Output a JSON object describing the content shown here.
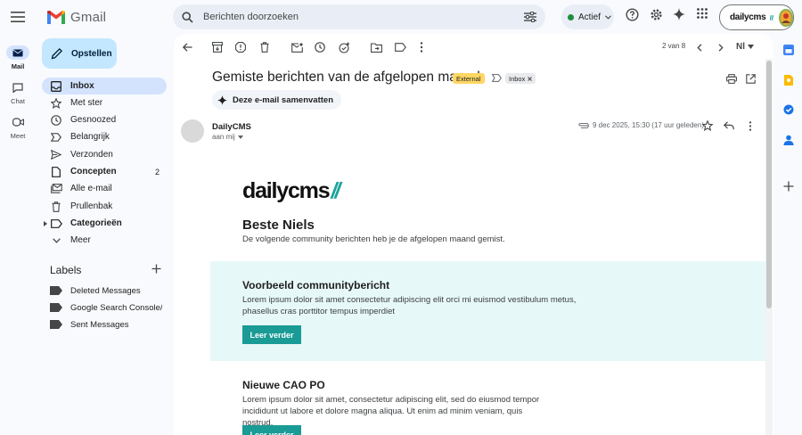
{
  "app": {
    "logo_text": "Gmail"
  },
  "search": {
    "placeholder": "Berichten doorzoeken"
  },
  "status": {
    "label": "Actief",
    "color": "#1e8e3e"
  },
  "account": {
    "brand": "dailycms"
  },
  "rail": [
    {
      "label": "Mail",
      "icon": "mail-icon"
    },
    {
      "label": "Chat",
      "icon": "chat-icon"
    },
    {
      "label": "Meet",
      "icon": "video-icon"
    }
  ],
  "compose": {
    "label": "Opstellen"
  },
  "nav": {
    "inbox": "Inbox",
    "starred": "Met ster",
    "snoozed": "Gesnoozed",
    "important": "Belangrijk",
    "sent": "Verzonden",
    "drafts": "Concepten",
    "drafts_count": "2",
    "all_mail": "Alle e-mail",
    "trash": "Prullenbak",
    "categories": "Categorieën",
    "more": "Meer"
  },
  "labels": {
    "heading": "Labels",
    "items": [
      "Deleted Messages",
      "Google Search Console/...",
      "Sent Messages"
    ]
  },
  "pager": {
    "text": "2 van 8",
    "lang": "Nl"
  },
  "message": {
    "subject": "Gemiste berichten van de afgelopen maand",
    "badge_external": "External",
    "badge_inbox": "Inbox",
    "summarize": "Deze e-mail samenvatten",
    "sender": "DailyCMS",
    "to": "aan mij",
    "datetime": "9 dec 2025, 15:30 (17 uur geleden)"
  },
  "email": {
    "logo_main": "dailycms",
    "logo_slash": "//",
    "greeting": "Beste Niels",
    "intro": "De volgende community berichten heb je de afgelopen maand gemist.",
    "posts": [
      {
        "title": "Voorbeeld communitybericht",
        "body": "Lorem ipsum dolor sit amet consectetur adipiscing elit orci mi euismod vestibulum metus, phasellus cras porttitor tempus imperdiet",
        "button": "Leer verder"
      },
      {
        "title": "Nieuwe CAO PO",
        "body": "Lorem ipsum dolor sit amet, consectetur adipiscing elit, sed do eiusmod tempor incididunt ut labore et dolore magna aliqua. Ut enim ad minim veniam, quis nostrud.",
        "button": "Leer verder"
      }
    ],
    "accent_color": "#1a9b96",
    "block_bg": "#e7f8f8"
  }
}
